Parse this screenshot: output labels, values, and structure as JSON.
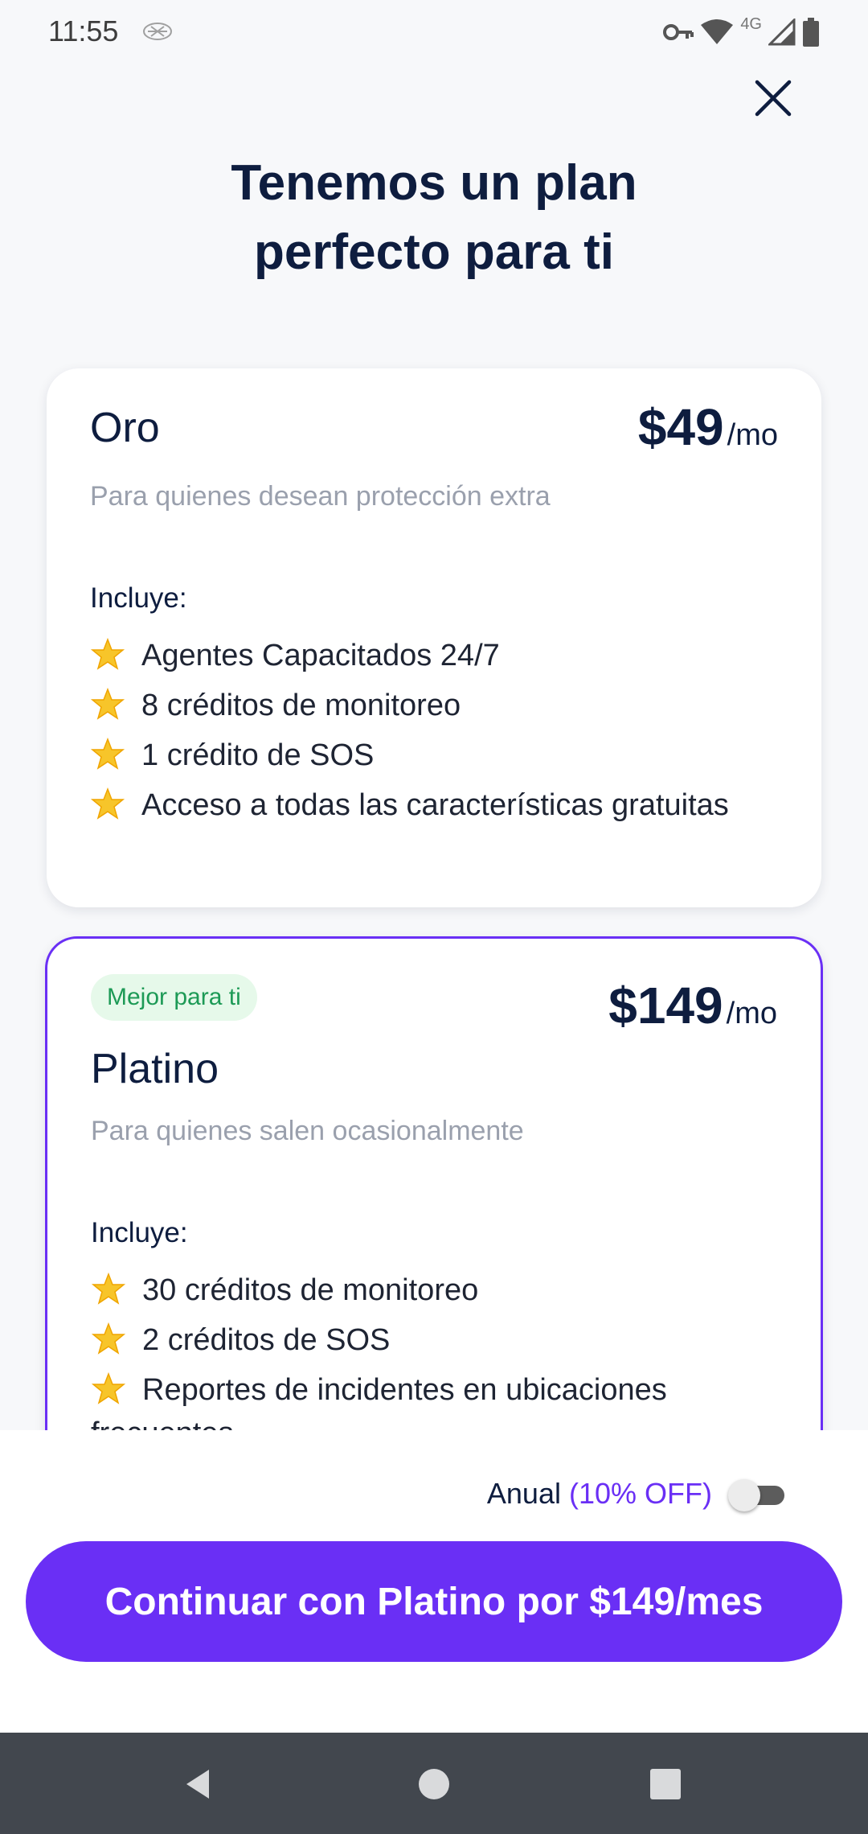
{
  "status_bar": {
    "time": "11:55",
    "network": "4G",
    "icons": [
      "weather-glyph-icon",
      "vpn-key-icon",
      "wifi-icon",
      "cell-signal-icon",
      "battery-icon"
    ]
  },
  "header": {
    "title_line1": "Tenemos un plan",
    "title_line2": "perfecto para ti",
    "close_icon": "close-icon"
  },
  "plans": [
    {
      "name": "Oro",
      "price": "$49",
      "unit": "/mo",
      "description": "Para quienes desean protección extra",
      "includes_label": "Incluye:",
      "features": [
        "Agentes Capacitados 24/7",
        "8 créditos de monitoreo",
        "1 crédito de SOS",
        "Acceso a todas las características gratuitas"
      ]
    },
    {
      "badge": "Mejor para ti",
      "name": "Platino",
      "price": "$149",
      "unit": "/mo",
      "description": "Para quienes salen ocasionalmente",
      "includes_label": "Incluye:",
      "features": [
        "30 créditos de monitoreo",
        "2 créditos de SOS",
        "Reportes de incidentes en ubicaciones frecuentes"
      ],
      "selected": true
    }
  ],
  "billing": {
    "annual_label": "Anual",
    "annual_discount": "(10% OFF)",
    "annual_enabled": false
  },
  "cta": {
    "label": "Continuar con Platino por $149/mes"
  },
  "colors": {
    "primary": "#6a2ff5",
    "title": "#0e1d3f",
    "muted": "#9aa0ad",
    "badge_bg": "#e6f9ea",
    "badge_text": "#1d9a56",
    "nav_bar": "#42474e"
  }
}
